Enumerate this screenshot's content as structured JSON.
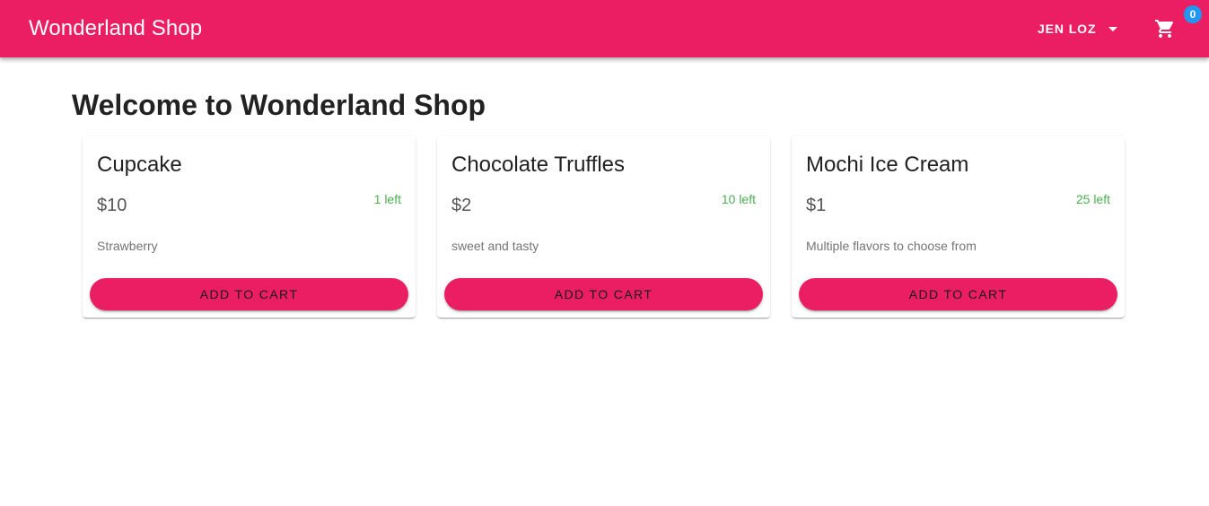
{
  "header": {
    "brand": "Wonderland Shop",
    "user_name": "JEN LOZ",
    "cart_count": "0",
    "icons": {
      "user_menu": "caret-down-icon",
      "cart": "shopping-cart-icon"
    },
    "colors": {
      "appbar": "#ec1e63",
      "badge": "#2196f3"
    }
  },
  "main": {
    "title": "Welcome to Wonderland Shop",
    "products": [
      {
        "name": "Cupcake",
        "price": "$10",
        "stock": "1 left",
        "description": "Strawberry",
        "button_label": "ADD TO CART"
      },
      {
        "name": "Chocolate Truffles",
        "price": "$2",
        "stock": "10 left",
        "description": "sweet and tasty",
        "button_label": "ADD TO CART"
      },
      {
        "name": "Mochi Ice Cream",
        "price": "$1",
        "stock": "25 left",
        "description": "Multiple flavors to choose from",
        "button_label": "ADD TO CART"
      }
    ],
    "colors": {
      "button": "#ec1e63",
      "stock": "#4caf50"
    }
  }
}
